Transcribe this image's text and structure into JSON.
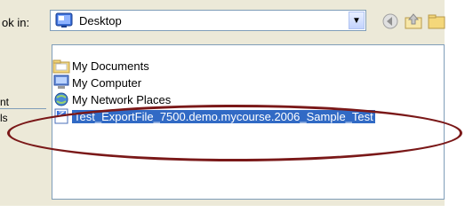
{
  "dialog": {
    "lookin_label": "ok in:",
    "lookin_value": "Desktop",
    "side_fragments": [
      "nt",
      "ls"
    ]
  },
  "list": {
    "items": [
      {
        "label": "My Documents",
        "icon": "folder-icon"
      },
      {
        "label": "My Computer",
        "icon": "computer-icon"
      },
      {
        "label": "My Network Places",
        "icon": "network-icon"
      },
      {
        "label": "Test_ExportFile_7500.demo.mycourse.2006_Sample_Test",
        "icon": "file-icon",
        "selected": true
      }
    ]
  },
  "colors": {
    "selection": "#316ac5",
    "annotation": "#7a1818",
    "window_bg": "#ece9d8"
  }
}
